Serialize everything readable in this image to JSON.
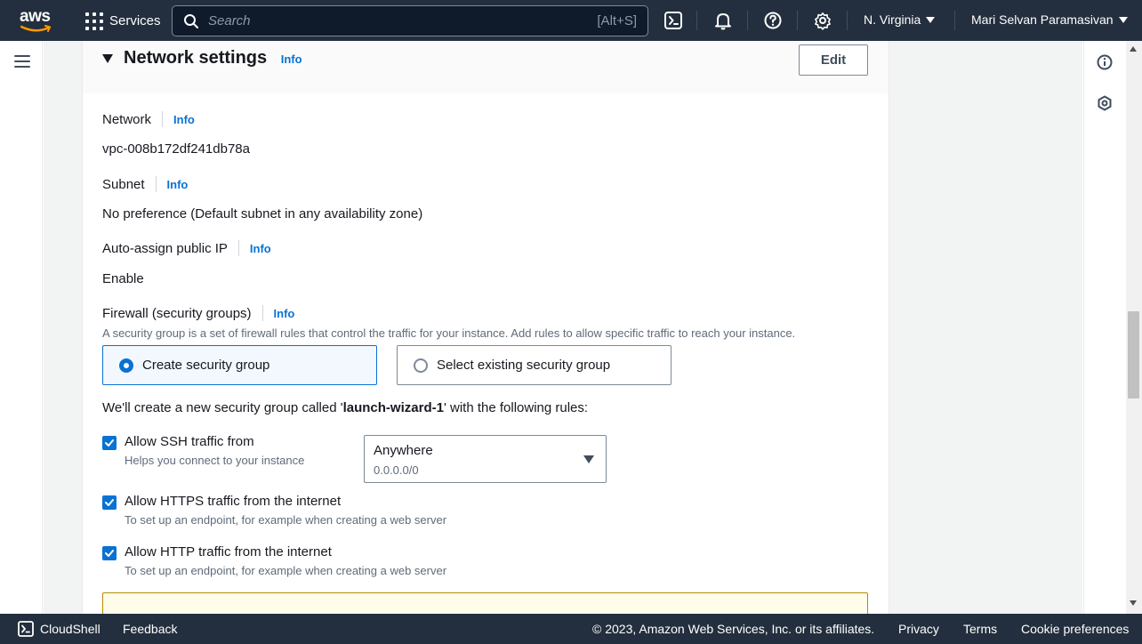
{
  "topnav": {
    "logo_text": "aws",
    "services_label": "Services",
    "search_placeholder": "Search",
    "search_shortcut": "[Alt+S]",
    "icons": [
      "cloudshell-icon",
      "bell-icon",
      "help-icon",
      "gear-icon"
    ],
    "region": "N. Virginia",
    "user": "Mari Selvan Paramasivan"
  },
  "panel": {
    "title": "Network settings",
    "title_info": "Info",
    "edit_label": "Edit",
    "network": {
      "label": "Network",
      "info": "Info",
      "value": "vpc-008b172df241db78a"
    },
    "subnet": {
      "label": "Subnet",
      "info": "Info",
      "value": "No preference (Default subnet in any availability zone)"
    },
    "public_ip": {
      "label": "Auto-assign public IP",
      "info": "Info",
      "value": "Enable"
    },
    "firewall": {
      "label": "Firewall (security groups)",
      "info": "Info",
      "description": "A security group is a set of firewall rules that control the traffic for your instance. Add rules to allow specific traffic to reach your instance.",
      "options": [
        {
          "label": "Create security group",
          "selected": true
        },
        {
          "label": "Select existing security group",
          "selected": false
        }
      ],
      "create_note_prefix": "We'll create a new security group called '",
      "create_note_name": "launch-wizard-1",
      "create_note_suffix": "' with the following rules:"
    },
    "rules": [
      {
        "label": "Allow SSH traffic from",
        "description": "Helps you connect to your instance",
        "checked": true
      },
      {
        "label": "Allow HTTPS traffic from the internet",
        "description": "To set up an endpoint, for example when creating a web server",
        "checked": true
      },
      {
        "label": "Allow HTTP traffic from the internet",
        "description": "To set up an endpoint, for example when creating a web server",
        "checked": true
      }
    ],
    "ssh_source": {
      "value": "Anywhere",
      "sub": "0.0.0.0/0"
    }
  },
  "footer": {
    "cloudshell": "CloudShell",
    "feedback": "Feedback",
    "copyright": "© 2023, Amazon Web Services, Inc. or its affiliates.",
    "privacy": "Privacy",
    "terms": "Terms",
    "cookie": "Cookie preferences"
  },
  "colors": {
    "nav_bg": "#232f3e",
    "accent": "#0972d3",
    "page_bg": "#f2f3f3",
    "warning_border": "#b58b00"
  }
}
